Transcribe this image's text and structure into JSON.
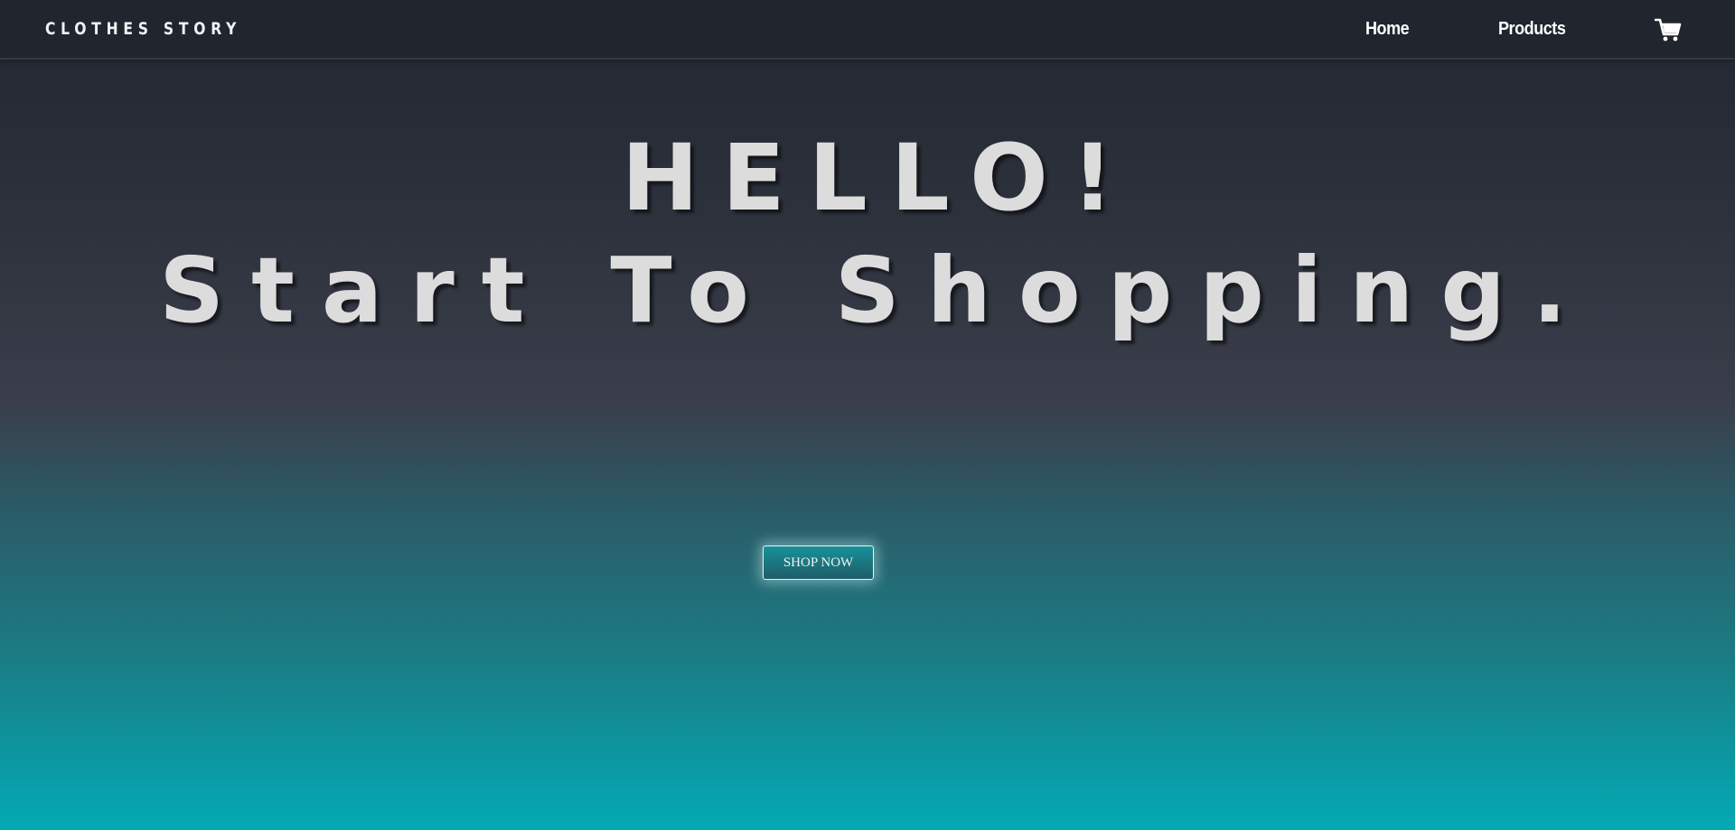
{
  "navbar": {
    "brand": "CLOTHES STORY",
    "links": [
      {
        "label": "Home"
      },
      {
        "label": "Products"
      }
    ],
    "cart_icon": "shopping-cart-icon"
  },
  "hero": {
    "line1": "HELLO!",
    "line2": "Start To Shopping.",
    "cta_label": "SHOP NOW"
  },
  "colors": {
    "navbar_bg": "#20252e",
    "gradient_top": "#21262f",
    "gradient_mid": "#3a3e4a",
    "gradient_bottom": "#02aab5",
    "hero_text": "#dcdcdc",
    "button_bg": "#17919a"
  }
}
